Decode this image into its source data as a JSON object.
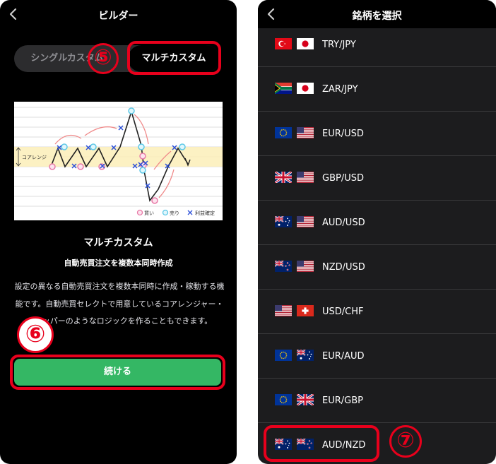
{
  "left": {
    "header_title": "ビルダー",
    "segment": {
      "option1": "シングルカスタム",
      "option2": "マルチカスタム"
    },
    "annotations": {
      "five": "⑤",
      "six": "⑥"
    },
    "diagram": {
      "band_label": "コアレンジ",
      "legend": {
        "buy": "買い",
        "sell": "売り",
        "take_profit": "利益確定"
      }
    },
    "title": "マルチカスタム",
    "subtitle": "自動売買注文を複数本同時作成",
    "description": "設定の異なる自動売買注文を複数本同時に作成・稼動する機能です。自動売買セレクトで用意しているコアレンジャー・スワッパーのようなロジックを作ることもできます。",
    "continue_button": "続ける"
  },
  "right": {
    "header_title": "銘柄を選択",
    "annotation_seven": "⑦",
    "pairs": [
      {
        "label": "TRY/JPY",
        "flag1": "turkey-flag",
        "flag2": "japan-flag"
      },
      {
        "label": "ZAR/JPY",
        "flag1": "south-africa-flag",
        "flag2": "japan-flag"
      },
      {
        "label": "EUR/USD",
        "flag1": "eu-flag",
        "flag2": "us-flag"
      },
      {
        "label": "GBP/USD",
        "flag1": "uk-flag",
        "flag2": "us-flag"
      },
      {
        "label": "AUD/USD",
        "flag1": "australia-flag",
        "flag2": "us-flag"
      },
      {
        "label": "NZD/USD",
        "flag1": "new-zealand-flag",
        "flag2": "us-flag"
      },
      {
        "label": "USD/CHF",
        "flag1": "us-flag",
        "flag2": "switzerland-flag"
      },
      {
        "label": "EUR/AUD",
        "flag1": "eu-flag",
        "flag2": "australia-flag"
      },
      {
        "label": "EUR/GBP",
        "flag1": "eu-flag",
        "flag2": "uk-flag"
      },
      {
        "label": "AUD/NZD",
        "flag1": "australia-flag",
        "flag2": "new-zealand-flag"
      }
    ]
  },
  "colors": {
    "accent_red": "#e8001c",
    "button_green": "#34b764",
    "buy_pink": "#e87aa7",
    "sell_cyan": "#5cc8e6",
    "x_blue": "#2b4fd8"
  }
}
